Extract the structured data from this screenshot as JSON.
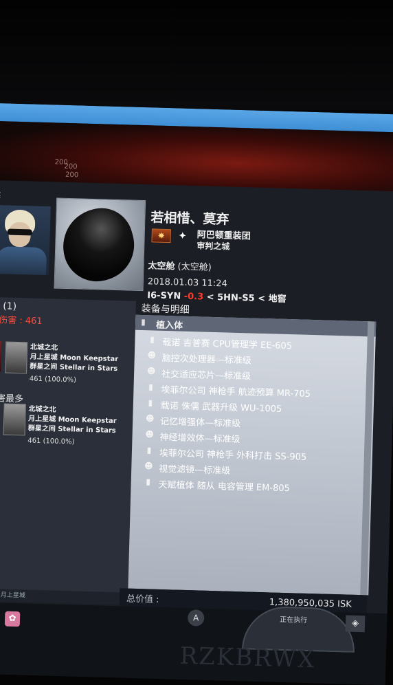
{
  "banner": {
    "num_a": "200",
    "num_b": "200",
    "num_c": "200"
  },
  "left_edge": {
    "text": "奖告"
  },
  "victim": {
    "name": "若相惜、莫弃",
    "corp": "阿巴顿重装团",
    "alliance": "审判之城",
    "ship": "太空舱",
    "ship_type": "(太空舱)",
    "date": "2018.01.03 11:24",
    "system": "I6-SYN",
    "security": "-0.3",
    "sep1": "<",
    "region1": "5HN-S5",
    "sep2": "<",
    "region2": "地窖"
  },
  "attackers": {
    "title": "者 (1)",
    "total_damage": "明伤害 : 461",
    "final_blow_label": "击",
    "top_damage_label": "伤害最多",
    "list": [
      {
        "name": "北城之北",
        "corp": "月上星城 Moon Keepstar",
        "alliance": "群星之间 Stellar in Stars",
        "damage": "461 (100.0%)"
      },
      {
        "name": "北城之北",
        "corp": "月上星城 Moon Keepstar",
        "alliance": "群星之间 Stellar in Stars",
        "damage": "461 (100.0%)"
      }
    ]
  },
  "fitting": {
    "header": "装备与明细",
    "group_label": "植入体",
    "items": [
      {
        "name": "载诺 吉普赛 CPU管理学 EE-605",
        "qty": "1",
        "icon": "implant-icon"
      },
      {
        "name": "脑控次处理器—标准级",
        "qty": "1",
        "icon": "skull-icon"
      },
      {
        "name": "社交适应芯片—标准级",
        "qty": "1",
        "icon": "skull-icon"
      },
      {
        "name": "埃菲尔公司 神枪手 航迹预算 MR-705",
        "qty": "1",
        "icon": "implant-icon"
      },
      {
        "name": "载诺 侏儒 武器升级 WU-1005",
        "qty": "1",
        "icon": "implant-icon"
      },
      {
        "name": "记忆增强体—标准级",
        "qty": "1",
        "icon": "skull-icon"
      },
      {
        "name": "神经增效体—标准级",
        "qty": "1",
        "icon": "skull-icon"
      },
      {
        "name": "埃菲尔公司 神枪手 外科打击 SS-905",
        "qty": "1",
        "icon": "implant-icon"
      },
      {
        "name": "视觉滤镜—标准级",
        "qty": "1",
        "icon": "skull-icon"
      },
      {
        "name": "天赋植体 随从 电容管理 EM-805",
        "qty": "1",
        "icon": "implant-icon"
      }
    ]
  },
  "total": {
    "label": "总价值 :",
    "value": "1,380,950,035 ISK"
  },
  "bottom": {
    "left_text": "总部 : 月上星城",
    "a_button": "A",
    "dial_text": "正在执行",
    "bg_text": "RZKBRWX"
  }
}
